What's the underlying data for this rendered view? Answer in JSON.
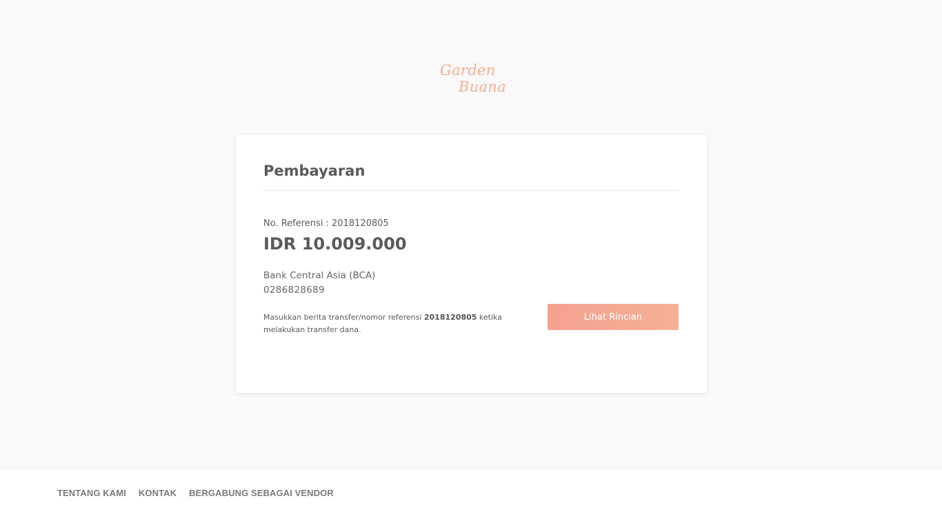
{
  "logo": {
    "line1": "Garden",
    "line2": "Buana",
    "color": "#f3ae92"
  },
  "card": {
    "title": "Pembayaran",
    "reference": "No. Referensi : 2018120805",
    "amount": "IDR 10.009.000",
    "bank_name": "Bank Central Asia (BCA)",
    "account_number": "0286828689",
    "note": {
      "before": "Masukkan berita transfer/nomor referensi ",
      "ref": "2018120805",
      "after": " ketika melakukan transfer dana."
    },
    "button_label": "Lihat Rincian",
    "accent_color": "#f4a190"
  },
  "footer": {
    "links": [
      "TENTANG KAMI",
      "KONTAK",
      "BERGABUNG SEBAGAI VENDOR"
    ]
  }
}
